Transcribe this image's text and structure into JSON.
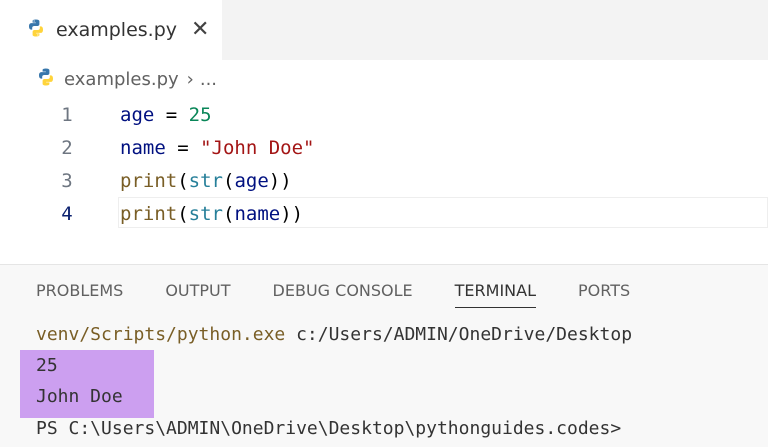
{
  "tab": {
    "label": "examples.py",
    "close": "✕"
  },
  "breadcrumb": {
    "file": "examples.py",
    "separator": "›",
    "more": "..."
  },
  "editor": {
    "lines": [
      {
        "number": "1",
        "tokens": [
          "age",
          " = ",
          "25"
        ]
      },
      {
        "number": "2",
        "tokens": [
          "name",
          " = ",
          "\"John Doe\""
        ]
      },
      {
        "number": "3",
        "tokens": [
          "print",
          "(",
          "str",
          "(",
          "age",
          "))"
        ]
      },
      {
        "number": "4",
        "tokens": [
          "print",
          "(",
          "str",
          "(",
          "name",
          "))"
        ]
      }
    ]
  },
  "panel": {
    "tabs": [
      "PROBLEMS",
      "OUTPUT",
      "DEBUG CONSOLE",
      "TERMINAL",
      "PORTS"
    ],
    "active_tab": "TERMINAL"
  },
  "terminal": {
    "cmd_exe": "venv/Scripts/python.exe",
    "cmd_args": " c:/Users/ADMIN/OneDrive/Desktop",
    "output1": "25",
    "output2": "John Doe",
    "prompt": "PS C:\\Users\\ADMIN\\OneDrive\\Desktop\\pythonguides.codes>"
  },
  "colors": {
    "highlight": "#cc9ff0",
    "python_blue": "#3776ab",
    "python_yellow": "#ffd43b"
  }
}
